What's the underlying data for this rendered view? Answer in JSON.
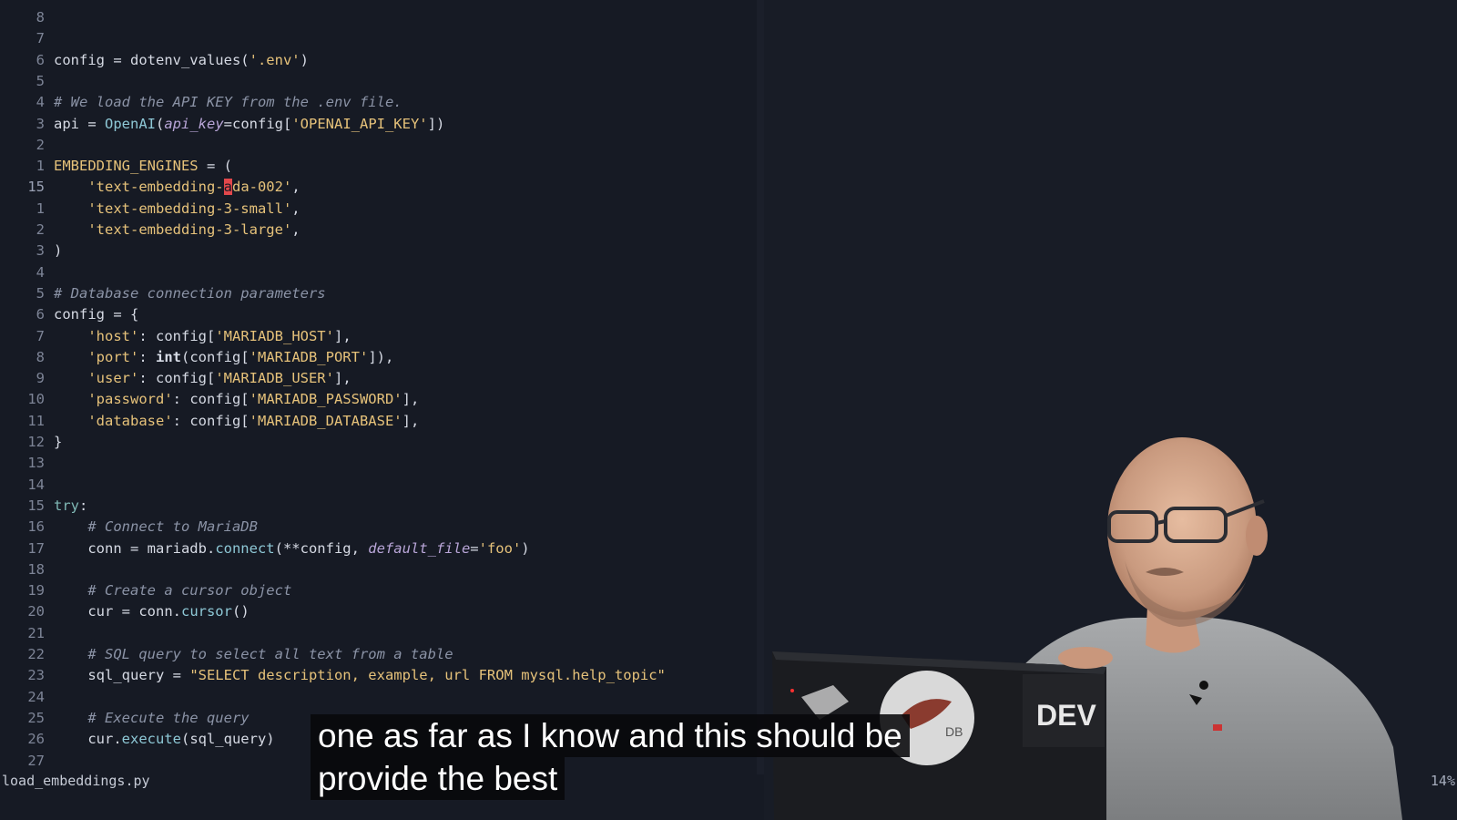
{
  "editor": {
    "lines": [
      {
        "num": "8",
        "html": ""
      },
      {
        "num": "7",
        "html": ""
      },
      {
        "num": "6",
        "html": "config = dotenv_values(<span class=\"str\">'.env'</span>)"
      },
      {
        "num": "5",
        "html": ""
      },
      {
        "num": "4",
        "html": "<span class=\"cmt\"># We load the API KEY from the .env file.</span>"
      },
      {
        "num": "3",
        "html": "api = <span class=\"fn\">OpenAI</span>(<span class=\"param\">api_key</span>=config[<span class=\"str\">'OPENAI_API_KEY'</span>])"
      },
      {
        "num": "2",
        "html": ""
      },
      {
        "num": "1",
        "html": "<span class=\"cst\">EMBEDDING_ENGINES</span> = ("
      },
      {
        "num": "15",
        "html": "    <span class=\"str\">'text-embedding-<span class=\"cursor\">a</span>da-002'</span>,",
        "current": true
      },
      {
        "num": "1",
        "html": "    <span class=\"str\">'text-embedding-3-small'</span>,"
      },
      {
        "num": "2",
        "html": "    <span class=\"str\">'text-embedding-3-large'</span>,"
      },
      {
        "num": "3",
        "html": ")"
      },
      {
        "num": "4",
        "html": ""
      },
      {
        "num": "5",
        "html": "<span class=\"cmt\"># Database connection parameters</span>"
      },
      {
        "num": "6",
        "html": "config = {"
      },
      {
        "num": "7",
        "html": "    <span class=\"str\">'host'</span>: config[<span class=\"str\">'MARIADB_HOST'</span>],"
      },
      {
        "num": "8",
        "html": "    <span class=\"str\">'port'</span>: <span class=\"builtin\">int</span>(config[<span class=\"str\">'MARIADB_PORT'</span>]),"
      },
      {
        "num": "9",
        "html": "    <span class=\"str\">'user'</span>: config[<span class=\"str\">'MARIADB_USER'</span>],"
      },
      {
        "num": "10",
        "html": "    <span class=\"str\">'password'</span>: config[<span class=\"str\">'MARIADB_PASSWORD'</span>],"
      },
      {
        "num": "11",
        "html": "    <span class=\"str\">'database'</span>: config[<span class=\"str\">'MARIADB_DATABASE'</span>],"
      },
      {
        "num": "12",
        "html": "}"
      },
      {
        "num": "13",
        "html": ""
      },
      {
        "num": "14",
        "html": ""
      },
      {
        "num": "15",
        "html": "<span class=\"kw\">try</span>:"
      },
      {
        "num": "16",
        "html": "    <span class=\"cmt\"># Connect to MariaDB</span>"
      },
      {
        "num": "17",
        "html": "    conn = mariadb.<span class=\"fn\">connect</span>(**config, <span class=\"param\">default_file</span>=<span class=\"str\">'foo'</span>)"
      },
      {
        "num": "18",
        "html": ""
      },
      {
        "num": "19",
        "html": "    <span class=\"cmt\"># Create a cursor object</span>"
      },
      {
        "num": "20",
        "html": "    cur = conn.<span class=\"fn\">cursor</span>()"
      },
      {
        "num": "21",
        "html": ""
      },
      {
        "num": "22",
        "html": "    <span class=\"cmt\"># SQL query to select all text from a table</span>"
      },
      {
        "num": "23",
        "html": "    sql_query = <span class=\"str\">\"SELECT description, example, url FROM mysql.help_topic\"</span>"
      },
      {
        "num": "24",
        "html": ""
      },
      {
        "num": "25",
        "html": "    <span class=\"cmt\"># Execute the query</span>"
      },
      {
        "num": "26",
        "html": "    cur.<span class=\"fn\">execute</span>(sql_query)"
      },
      {
        "num": "27",
        "html": ""
      }
    ]
  },
  "statusbar": {
    "filename": "load_embeddings.py",
    "percent": "14%"
  },
  "webcam": {
    "laptop_sticker_text": "DEV",
    "logo_text": "DB"
  },
  "subtitle": {
    "line1": "one as far as I know and this should be",
    "line2": "provide the best"
  },
  "colors": {
    "background": "#161a24",
    "string": "#e6c27a",
    "comment": "#8b93a6",
    "function": "#8ec8d6",
    "cursor": "#e2474b"
  }
}
